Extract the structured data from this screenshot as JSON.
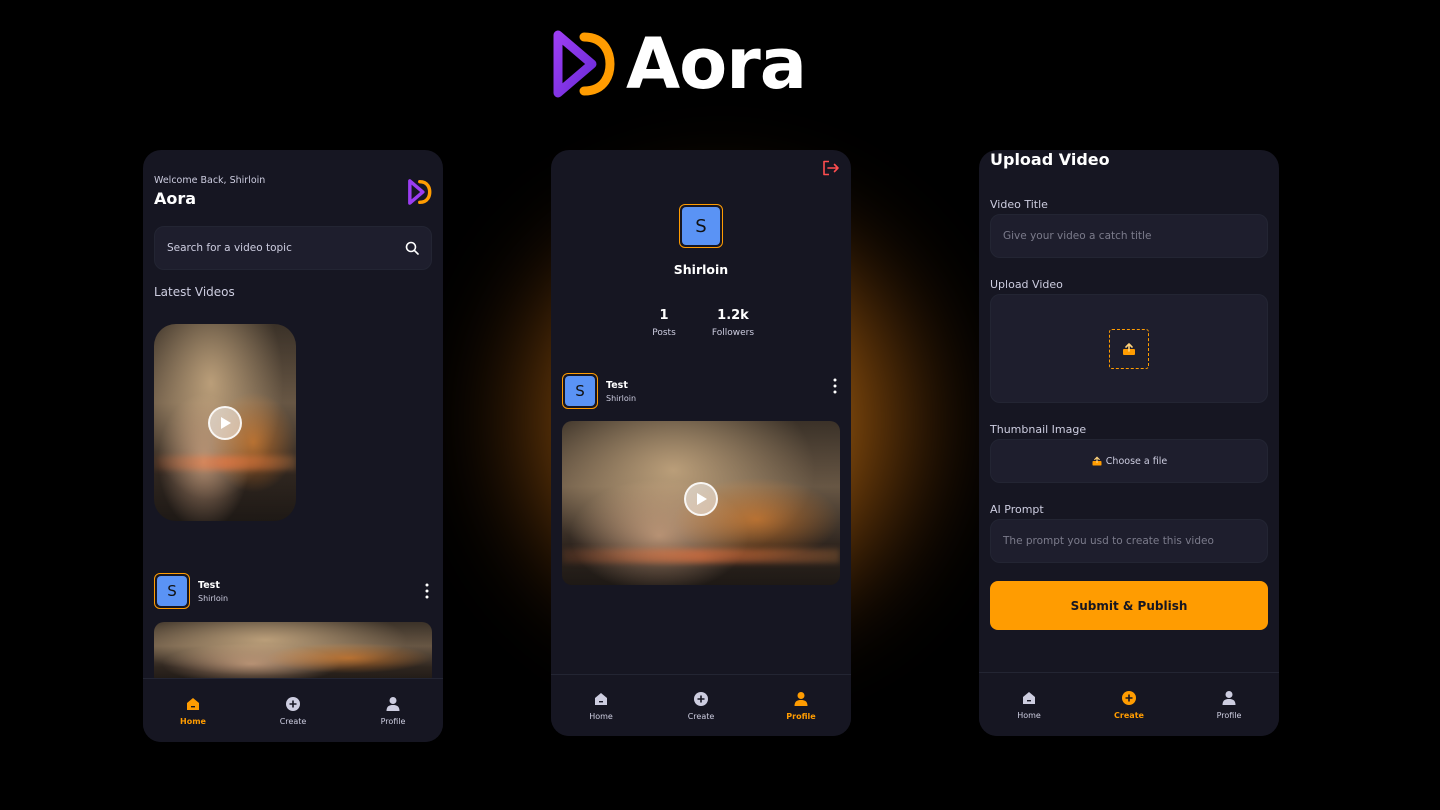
{
  "brand": {
    "name": "Aora",
    "logo_icon": "aora-logo-icon"
  },
  "colors": {
    "accent": "#FF9C01",
    "background": "#161622",
    "field": "#1E1E2D",
    "logo_purple": "#9B3DF2",
    "logo_orange": "#FF9C01",
    "logout": "#FF4D4F"
  },
  "home": {
    "welcome": "Welcome Back, Shirloin",
    "title": "Aora",
    "search": {
      "placeholder": "Search for a video topic"
    },
    "section_title": "Latest Videos",
    "post": {
      "title": "Test",
      "author": "Shirloin",
      "avatar_letter": "S"
    }
  },
  "profile": {
    "avatar_letter": "S",
    "username": "Shirloin",
    "stats": [
      {
        "value": "1",
        "label": "Posts"
      },
      {
        "value": "1.2k",
        "label": "Followers"
      }
    ],
    "post": {
      "title": "Test",
      "author": "Shirloin",
      "avatar_letter": "S"
    }
  },
  "create": {
    "title": "Upload Video",
    "video_title": {
      "label": "Video Title",
      "placeholder": "Give your video a catch title"
    },
    "upload_video": {
      "label": "Upload Video"
    },
    "thumbnail": {
      "label": "Thumbnail Image",
      "button": "Choose a file"
    },
    "ai_prompt": {
      "label": "AI Prompt",
      "placeholder": "The prompt you usd to create this video"
    },
    "submit": "Submit & Publish"
  },
  "tabs": [
    {
      "label": "Home",
      "icon": "home-icon"
    },
    {
      "label": "Create",
      "icon": "plus-circle-icon"
    },
    {
      "label": "Profile",
      "icon": "user-icon"
    }
  ]
}
